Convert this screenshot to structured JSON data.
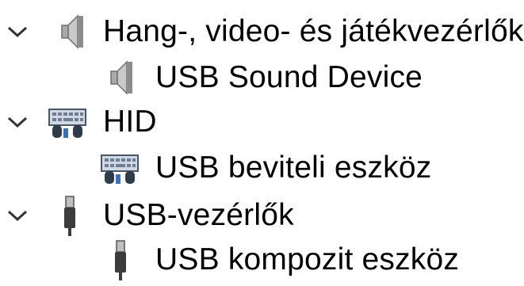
{
  "tree": {
    "nodes": [
      {
        "label": "Hang-, video- és játékvezérlők",
        "icon": "speaker-icon",
        "expanded": true,
        "level": 0
      },
      {
        "label": "USB Sound Device",
        "icon": "speaker-icon",
        "level": 1
      },
      {
        "label": "HID",
        "icon": "keyboard-mouse-icon",
        "expanded": true,
        "level": 0
      },
      {
        "label": "USB beviteli eszköz",
        "icon": "keyboard-mouse-icon",
        "level": 1
      },
      {
        "label": "USB-vezérlők",
        "icon": "usb-plug-icon",
        "expanded": true,
        "level": 0
      },
      {
        "label": "USB kompozit eszköz",
        "icon": "usb-plug-icon",
        "level": 1
      }
    ]
  }
}
